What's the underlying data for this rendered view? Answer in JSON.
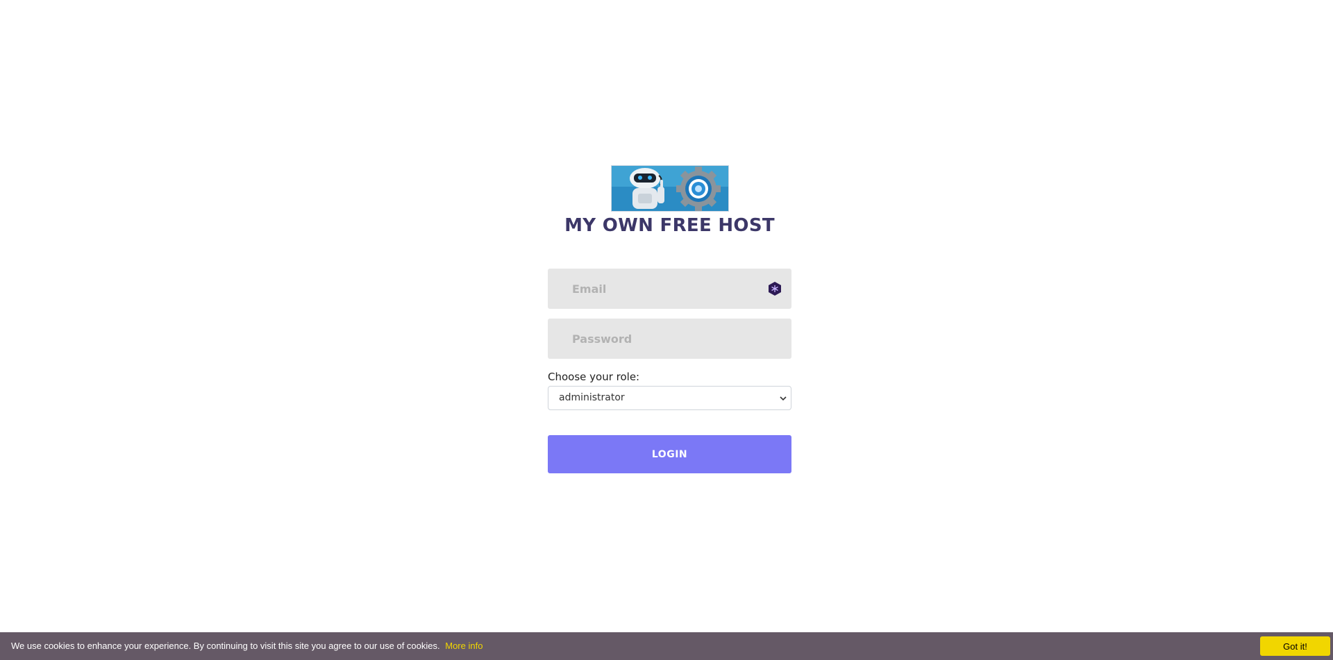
{
  "logo": {
    "alt": "robot and gear logo",
    "icon": "robot-logo-icon"
  },
  "site_title": "MY OWN FREE HOST",
  "email": {
    "placeholder": "Email",
    "value": "",
    "icon": "password-manager-icon"
  },
  "password": {
    "placeholder": "Password",
    "value": ""
  },
  "role": {
    "label": "Choose your role:",
    "selected": "administrator",
    "icon": "chevron-down-icon"
  },
  "login_button": "LOGIN",
  "cookie": {
    "text": "We use cookies to enhance your experience. By continuing to visit this site you agree to our use of cookies.",
    "link": "More info",
    "button": "Got it!"
  },
  "colors": {
    "title": "#3c3768",
    "login_button": "#7b78f6",
    "input_bg": "#e6e6e6",
    "cookie_bar": "#655966",
    "cookie_accent": "#f1d600"
  }
}
